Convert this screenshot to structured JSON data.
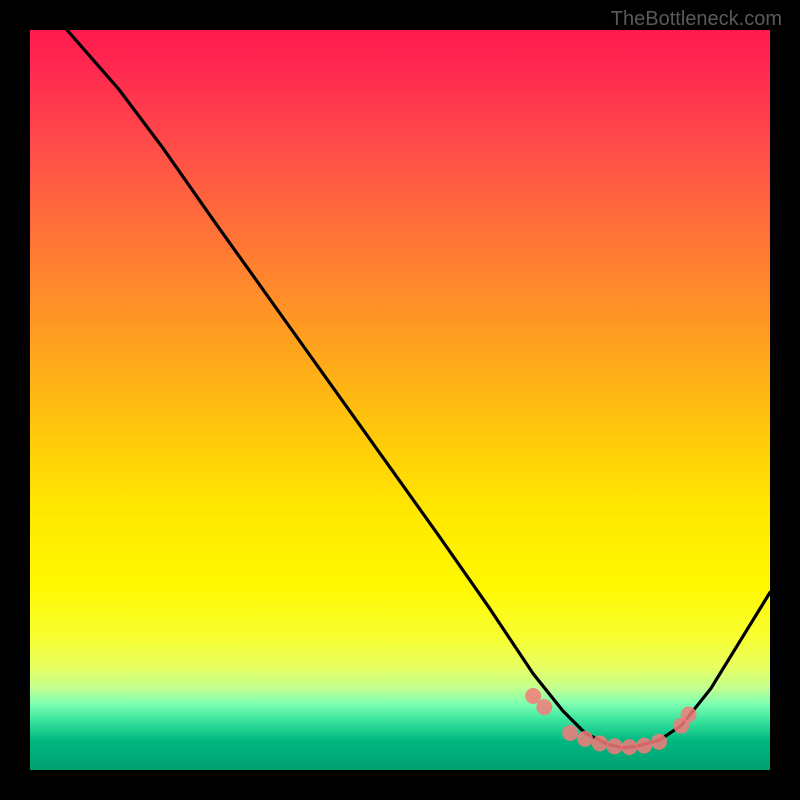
{
  "watermark": "TheBottleneck.com",
  "chart_data": {
    "type": "line",
    "title": "",
    "xlabel": "",
    "ylabel": "",
    "xlim": [
      0,
      100
    ],
    "ylim": [
      0,
      100
    ],
    "note": "Axes are unlabeled; x/y are in percent of plot area. Curve is a V-shaped line with minimum (best) near x≈80. Circular markers highlight the low region near the bottom.",
    "series": [
      {
        "name": "curve",
        "x": [
          5,
          12,
          18,
          25,
          35,
          45,
          55,
          62,
          68,
          72,
          75,
          78,
          80,
          82,
          85,
          88,
          92,
          100
        ],
        "y": [
          100,
          92,
          84,
          74,
          60,
          46,
          32,
          22,
          13,
          8,
          5,
          3.5,
          3,
          3.2,
          4,
          6,
          11,
          24
        ]
      }
    ],
    "markers": {
      "name": "highlight-points",
      "color": "#f47a7a",
      "x": [
        68,
        69.5,
        73,
        75,
        77,
        79,
        81,
        83,
        85,
        88,
        89
      ],
      "y": [
        10,
        8.5,
        5,
        4.2,
        3.6,
        3.2,
        3.1,
        3.3,
        3.8,
        6,
        7.5
      ]
    },
    "gradient_stops": [
      {
        "pos": 0,
        "color": "#ff1a4d"
      },
      {
        "pos": 50,
        "color": "#ffca0a"
      },
      {
        "pos": 80,
        "color": "#fff800"
      },
      {
        "pos": 92,
        "color": "#40e8a0"
      },
      {
        "pos": 100,
        "color": "#00a070"
      }
    ]
  }
}
